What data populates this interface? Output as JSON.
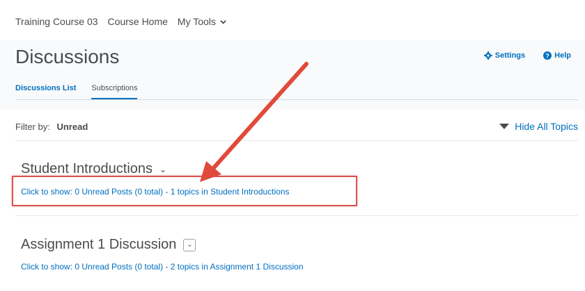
{
  "nav": {
    "course": "Training Course 03",
    "home": "Course Home",
    "tools": "My Tools"
  },
  "page": {
    "title": "Discussions",
    "settings": "Settings",
    "help": "Help"
  },
  "tabs": {
    "list": "Discussions List",
    "subscriptions": "Subscriptions"
  },
  "filter": {
    "label": "Filter by:",
    "value": "Unread",
    "hide_all": "Hide All Topics"
  },
  "forums": [
    {
      "title": "Student Introductions",
      "link": "Click to show: 0 Unread Posts (0 total) - 1 topics in Student Introductions"
    },
    {
      "title": "Assignment 1 Discussion",
      "link": "Click to show: 0 Unread Posts (0 total) - 2 topics in Assignment 1 Discussion"
    }
  ],
  "colors": {
    "link": "#006fbf",
    "annotation": "#d9534f"
  }
}
